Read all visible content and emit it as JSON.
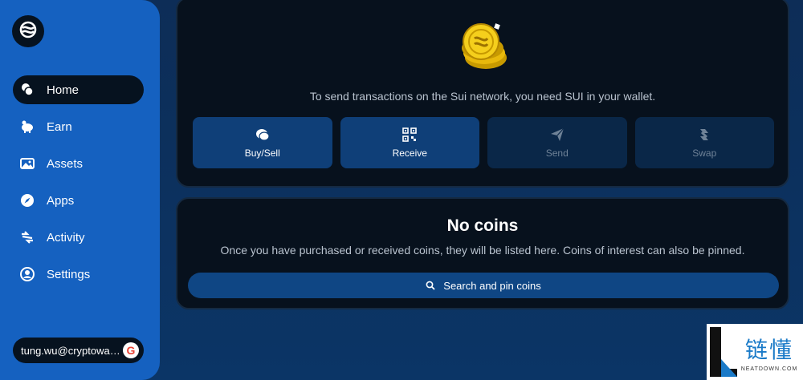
{
  "sidebar": {
    "items": [
      {
        "label": "Home",
        "icon": "coins-icon",
        "active": true
      },
      {
        "label": "Earn",
        "icon": "piggy-bank-icon",
        "active": false
      },
      {
        "label": "Assets",
        "icon": "image-icon",
        "active": false
      },
      {
        "label": "Apps",
        "icon": "compass-icon",
        "active": false
      },
      {
        "label": "Activity",
        "icon": "activity-icon",
        "active": false
      },
      {
        "label": "Settings",
        "icon": "user-circle-icon",
        "active": false
      }
    ],
    "account": {
      "email": "tung.wu@cryptowallet.com",
      "provider_icon": "google-icon"
    }
  },
  "wallet": {
    "notice": "To send transactions on the Sui network, you need SUI in your wallet.",
    "actions": [
      {
        "label": "Buy/Sell",
        "icon": "coin-icon",
        "enabled": true
      },
      {
        "label": "Receive",
        "icon": "qr-code-icon",
        "enabled": true
      },
      {
        "label": "Send",
        "icon": "paper-plane-icon",
        "enabled": false
      },
      {
        "label": "Swap",
        "icon": "swap-icon",
        "enabled": false
      }
    ]
  },
  "coins": {
    "title": "No coins",
    "description": "Once you have purchased or received coins, they will be listed here. Coins of interest can also be pinned.",
    "search_button": "Search and pin coins"
  },
  "watermark": {
    "cn": "链懂",
    "en": "NEATDOWN.COM"
  },
  "colors": {
    "sidebar": "#1561c0",
    "panel": "#07111d",
    "action_enabled": "#0f3f78",
    "action_disabled": "#0a2748",
    "background": "#0d2d57"
  }
}
